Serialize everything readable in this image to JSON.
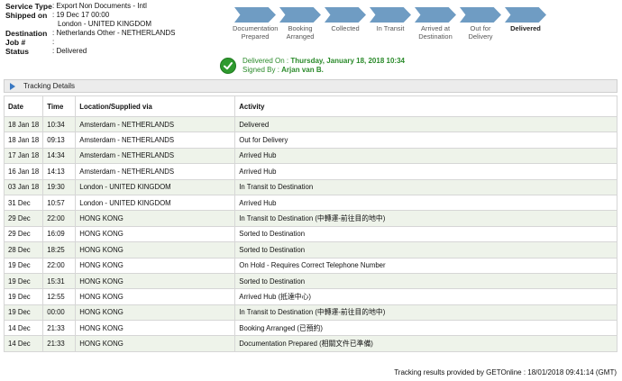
{
  "shipment": {
    "service_type_label": "Service Type",
    "service_type": ": Export Non Documents - Intl",
    "shipped_on_label": "Shipped on",
    "shipped_on": ": 19 Dec 17 00:00",
    "origin": "London - UNITED KINGDOM",
    "destination_label": "Destination",
    "destination": ": Netherlands Other - NETHERLANDS",
    "job_label": "Job #",
    "job": ":",
    "status_label": "Status",
    "status": ": Delivered"
  },
  "steps": [
    {
      "label": "Documentation Prepared",
      "active": false
    },
    {
      "label": "Booking Arranged",
      "active": false
    },
    {
      "label": "Collected",
      "active": false
    },
    {
      "label": "In Transit",
      "active": false
    },
    {
      "label": "Arrived at Destination",
      "active": false
    },
    {
      "label": "Out for Delivery",
      "active": false
    },
    {
      "label": "Delivered",
      "active": true
    }
  ],
  "delivery": {
    "delivered_on_label": "Delivered On :",
    "delivered_on": "Thursday, January 18, 2018 10:34",
    "signed_by_label": "Signed By :",
    "signed_by": "Arjan van B."
  },
  "tracking": {
    "title": "Tracking Details",
    "columns": [
      "Date",
      "Time",
      "Location/Supplied via",
      "Activity"
    ],
    "rows": [
      [
        "18 Jan 18",
        "10:34",
        "Amsterdam - NETHERLANDS",
        "Delivered"
      ],
      [
        "18 Jan 18",
        "09:13",
        "Amsterdam - NETHERLANDS",
        "Out for Delivery"
      ],
      [
        "17 Jan 18",
        "14:34",
        "Amsterdam - NETHERLANDS",
        "Arrived Hub"
      ],
      [
        "16 Jan 18",
        "14:13",
        "Amsterdam - NETHERLANDS",
        "Arrived Hub"
      ],
      [
        "03 Jan 18",
        "19:30",
        "London - UNITED KINGDOM",
        "In Transit to Destination"
      ],
      [
        "31 Dec",
        "10:57",
        "London - UNITED KINGDOM",
        "Arrived Hub"
      ],
      [
        "29 Dec",
        "22:00",
        "HONG KONG",
        "In Transit to Destination (中轉運-前往目的地中)"
      ],
      [
        "29 Dec",
        "16:09",
        "HONG KONG",
        "Sorted to Destination"
      ],
      [
        "28 Dec",
        "18:25",
        "HONG KONG",
        "Sorted to Destination"
      ],
      [
        "19 Dec",
        "22:00",
        "HONG KONG",
        "On Hold - Requires Correct Telephone Number"
      ],
      [
        "19 Dec",
        "15:31",
        "HONG KONG",
        "Sorted to Destination"
      ],
      [
        "19 Dec",
        "12:55",
        "HONG KONG",
        "Arrived Hub (抵達中心)"
      ],
      [
        "19 Dec",
        "00:00",
        "HONG KONG",
        "In Transit to Destination (中轉運-前往目的地中)"
      ],
      [
        "14 Dec",
        "21:33",
        "HONG KONG",
        "Booking Arranged (已預約)"
      ],
      [
        "14 Dec",
        "21:33",
        "HONG KONG",
        "Documentation Prepared (相關文件已準備)"
      ]
    ]
  },
  "footer": "Tracking results provided by GETOnline : 18/01/2018 09:41:14 (GMT)",
  "colors": {
    "step_arrow": "#6f9cc3",
    "delivered_green": "#2a8a2a",
    "row_alt": "#eef3ea"
  }
}
